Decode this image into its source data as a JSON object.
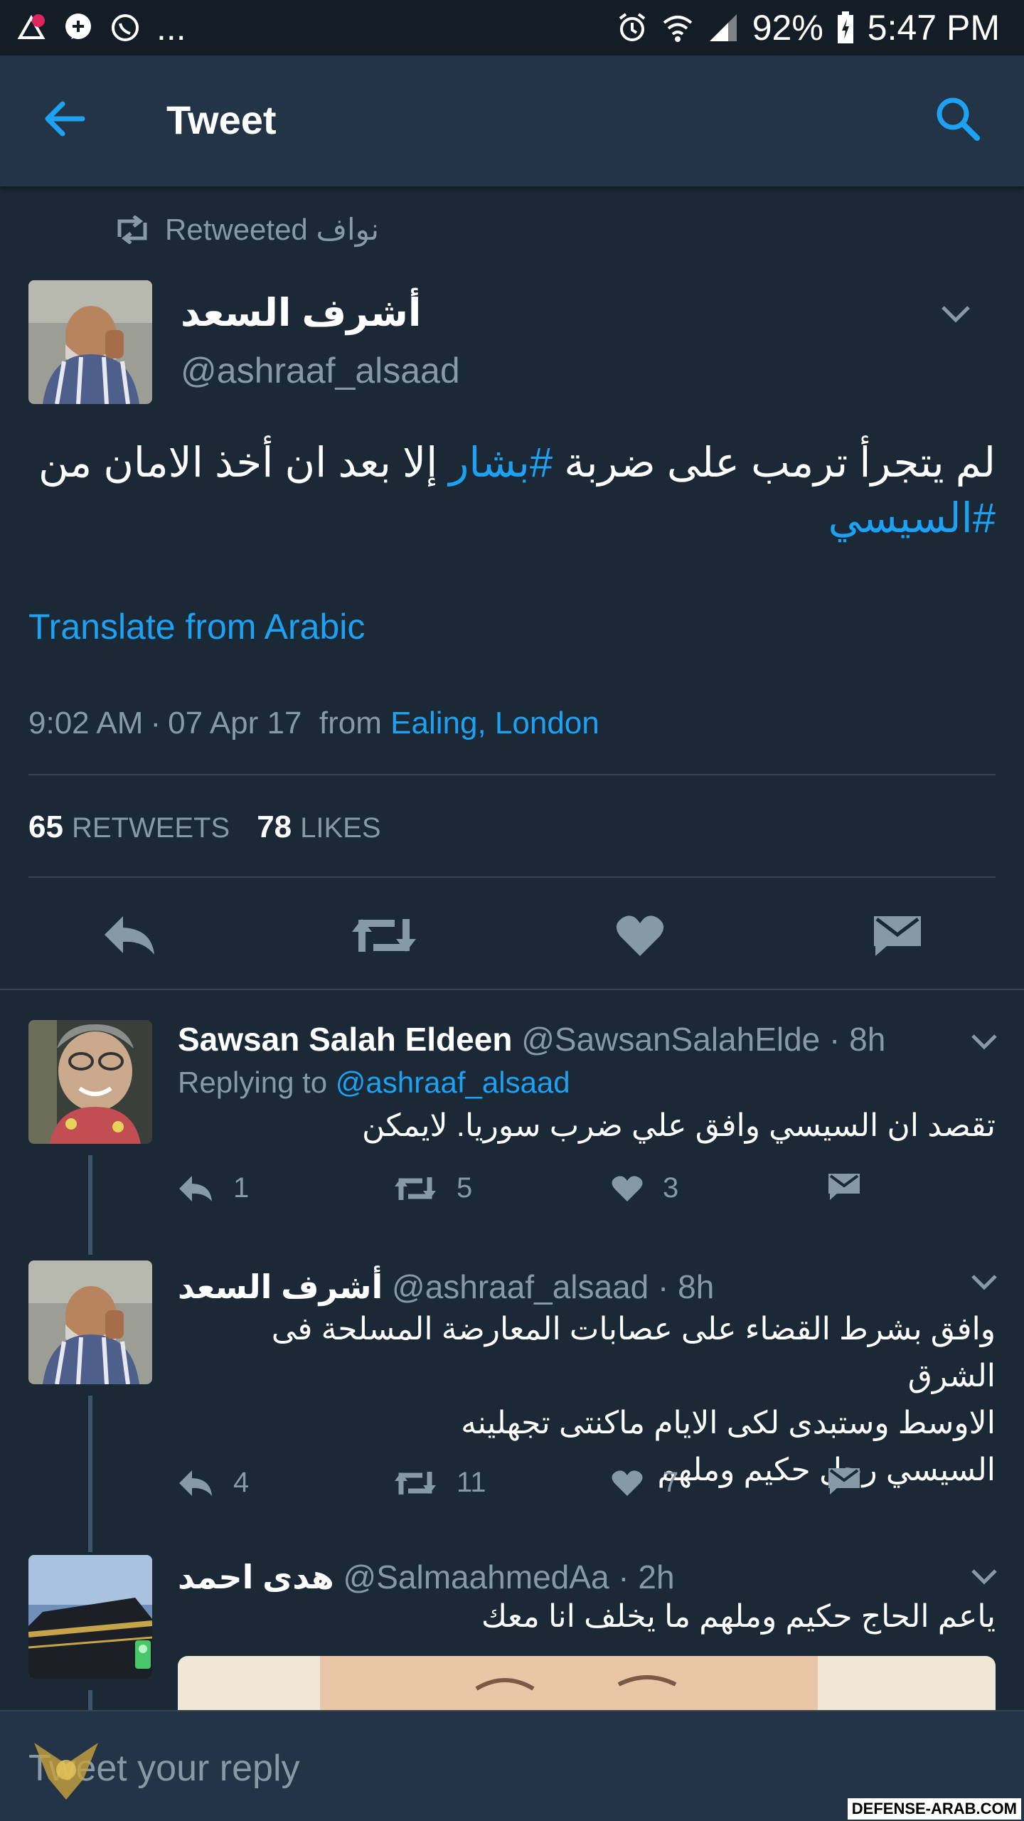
{
  "statusbar": {
    "overflow": "...",
    "battery": "92%",
    "time": "5:47 PM"
  },
  "header": {
    "title": "Tweet"
  },
  "tweet": {
    "retweeted_by": "Retweeted نواف",
    "author_name": "أشرف السعد",
    "author_handle": "@ashraaf_alsaad",
    "text_part1": "لم يتجرأ ترمب على ضربة ",
    "hashtag1": "#بشار",
    "text_part2": " إلا بعد ان أخذ الامان من ",
    "hashtag2": "#السيسي",
    "translate": "Translate from Arabic",
    "time": "9:02 AM",
    "date": "07 Apr 17",
    "from_label": "from",
    "location": "Ealing, London",
    "retweets_count": "65",
    "retweets_label": "RETWEETS",
    "likes_count": "78",
    "likes_label": "LIKES"
  },
  "replies": [
    {
      "name": "Sawsan Salah Eldeen",
      "handle_time": "@SawsanSalahElde · 8h",
      "replying_label": "Replying to",
      "replying_to": "@ashraaf_alsaad",
      "text": "تقصد ان السيسي وافق علي ضرب سوريا. لايمكن",
      "replies": "1",
      "retweets": "5",
      "likes": "3"
    },
    {
      "name": "أشرف السعد",
      "handle_time": "@ashraaf_alsaad · 8h",
      "line1": "وافق بشرط القضاء على عصابات المعارضة المسلحة فى الشرق",
      "line2": "الاوسط وستبدى لكى الايام ماكنتى تجهلينه",
      "line3": "السيسي رجل حكيم وملهم",
      "replies": "4",
      "retweets": "11",
      "likes": "7"
    },
    {
      "name": "هدى احمد",
      "handle_time": "@SalmaahmedAa · 2h",
      "text": "ياعم الحاج حكيم وملهم ما يخلف انا معك"
    }
  ],
  "composer": {
    "placeholder": "Tweet your reply"
  },
  "watermark": "DEFENSE-ARAB.COM",
  "colors": {
    "background": "#1b2836",
    "header": "#243447",
    "accent": "#1da1f2",
    "muted": "#8899a6"
  }
}
